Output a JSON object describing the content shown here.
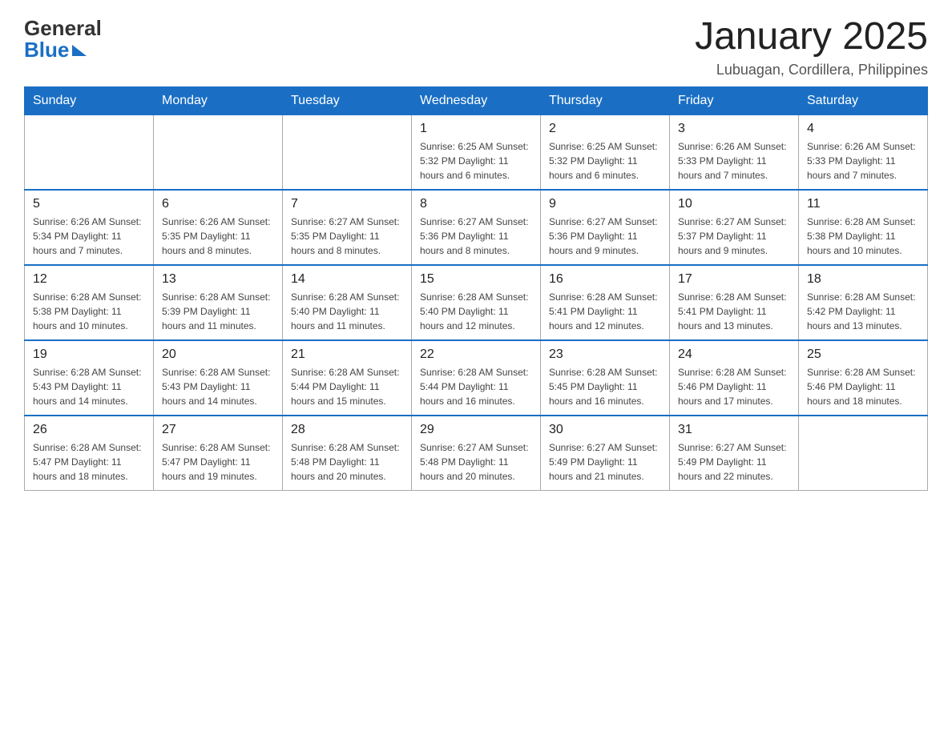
{
  "header": {
    "logo_general": "General",
    "logo_blue": "Blue",
    "title": "January 2025",
    "location": "Lubuagan, Cordillera, Philippines"
  },
  "calendar": {
    "days_of_week": [
      "Sunday",
      "Monday",
      "Tuesday",
      "Wednesday",
      "Thursday",
      "Friday",
      "Saturday"
    ],
    "weeks": [
      {
        "days": [
          {
            "date": "",
            "info": ""
          },
          {
            "date": "",
            "info": ""
          },
          {
            "date": "",
            "info": ""
          },
          {
            "date": "1",
            "info": "Sunrise: 6:25 AM\nSunset: 5:32 PM\nDaylight: 11 hours and 6 minutes."
          },
          {
            "date": "2",
            "info": "Sunrise: 6:25 AM\nSunset: 5:32 PM\nDaylight: 11 hours and 6 minutes."
          },
          {
            "date": "3",
            "info": "Sunrise: 6:26 AM\nSunset: 5:33 PM\nDaylight: 11 hours and 7 minutes."
          },
          {
            "date": "4",
            "info": "Sunrise: 6:26 AM\nSunset: 5:33 PM\nDaylight: 11 hours and 7 minutes."
          }
        ]
      },
      {
        "days": [
          {
            "date": "5",
            "info": "Sunrise: 6:26 AM\nSunset: 5:34 PM\nDaylight: 11 hours and 7 minutes."
          },
          {
            "date": "6",
            "info": "Sunrise: 6:26 AM\nSunset: 5:35 PM\nDaylight: 11 hours and 8 minutes."
          },
          {
            "date": "7",
            "info": "Sunrise: 6:27 AM\nSunset: 5:35 PM\nDaylight: 11 hours and 8 minutes."
          },
          {
            "date": "8",
            "info": "Sunrise: 6:27 AM\nSunset: 5:36 PM\nDaylight: 11 hours and 8 minutes."
          },
          {
            "date": "9",
            "info": "Sunrise: 6:27 AM\nSunset: 5:36 PM\nDaylight: 11 hours and 9 minutes."
          },
          {
            "date": "10",
            "info": "Sunrise: 6:27 AM\nSunset: 5:37 PM\nDaylight: 11 hours and 9 minutes."
          },
          {
            "date": "11",
            "info": "Sunrise: 6:28 AM\nSunset: 5:38 PM\nDaylight: 11 hours and 10 minutes."
          }
        ]
      },
      {
        "days": [
          {
            "date": "12",
            "info": "Sunrise: 6:28 AM\nSunset: 5:38 PM\nDaylight: 11 hours and 10 minutes."
          },
          {
            "date": "13",
            "info": "Sunrise: 6:28 AM\nSunset: 5:39 PM\nDaylight: 11 hours and 11 minutes."
          },
          {
            "date": "14",
            "info": "Sunrise: 6:28 AM\nSunset: 5:40 PM\nDaylight: 11 hours and 11 minutes."
          },
          {
            "date": "15",
            "info": "Sunrise: 6:28 AM\nSunset: 5:40 PM\nDaylight: 11 hours and 12 minutes."
          },
          {
            "date": "16",
            "info": "Sunrise: 6:28 AM\nSunset: 5:41 PM\nDaylight: 11 hours and 12 minutes."
          },
          {
            "date": "17",
            "info": "Sunrise: 6:28 AM\nSunset: 5:41 PM\nDaylight: 11 hours and 13 minutes."
          },
          {
            "date": "18",
            "info": "Sunrise: 6:28 AM\nSunset: 5:42 PM\nDaylight: 11 hours and 13 minutes."
          }
        ]
      },
      {
        "days": [
          {
            "date": "19",
            "info": "Sunrise: 6:28 AM\nSunset: 5:43 PM\nDaylight: 11 hours and 14 minutes."
          },
          {
            "date": "20",
            "info": "Sunrise: 6:28 AM\nSunset: 5:43 PM\nDaylight: 11 hours and 14 minutes."
          },
          {
            "date": "21",
            "info": "Sunrise: 6:28 AM\nSunset: 5:44 PM\nDaylight: 11 hours and 15 minutes."
          },
          {
            "date": "22",
            "info": "Sunrise: 6:28 AM\nSunset: 5:44 PM\nDaylight: 11 hours and 16 minutes."
          },
          {
            "date": "23",
            "info": "Sunrise: 6:28 AM\nSunset: 5:45 PM\nDaylight: 11 hours and 16 minutes."
          },
          {
            "date": "24",
            "info": "Sunrise: 6:28 AM\nSunset: 5:46 PM\nDaylight: 11 hours and 17 minutes."
          },
          {
            "date": "25",
            "info": "Sunrise: 6:28 AM\nSunset: 5:46 PM\nDaylight: 11 hours and 18 minutes."
          }
        ]
      },
      {
        "days": [
          {
            "date": "26",
            "info": "Sunrise: 6:28 AM\nSunset: 5:47 PM\nDaylight: 11 hours and 18 minutes."
          },
          {
            "date": "27",
            "info": "Sunrise: 6:28 AM\nSunset: 5:47 PM\nDaylight: 11 hours and 19 minutes."
          },
          {
            "date": "28",
            "info": "Sunrise: 6:28 AM\nSunset: 5:48 PM\nDaylight: 11 hours and 20 minutes."
          },
          {
            "date": "29",
            "info": "Sunrise: 6:27 AM\nSunset: 5:48 PM\nDaylight: 11 hours and 20 minutes."
          },
          {
            "date": "30",
            "info": "Sunrise: 6:27 AM\nSunset: 5:49 PM\nDaylight: 11 hours and 21 minutes."
          },
          {
            "date": "31",
            "info": "Sunrise: 6:27 AM\nSunset: 5:49 PM\nDaylight: 11 hours and 22 minutes."
          },
          {
            "date": "",
            "info": ""
          }
        ]
      }
    ]
  }
}
